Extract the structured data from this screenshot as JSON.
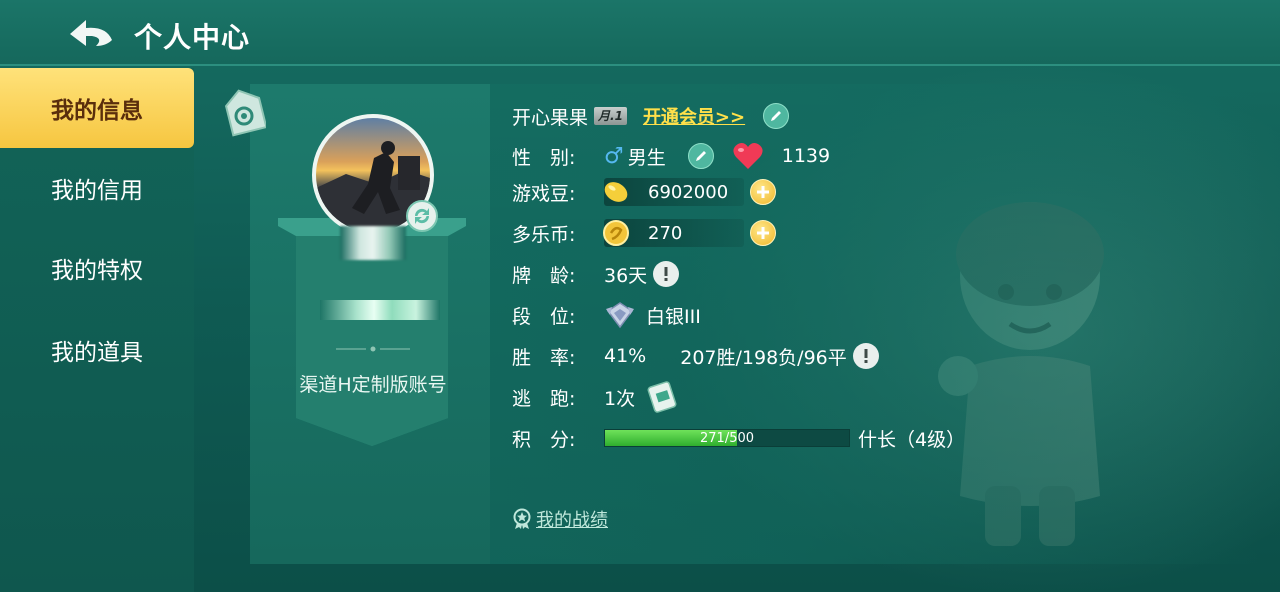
{
  "header": {
    "title": "个人中心"
  },
  "sidebar": {
    "items": [
      {
        "label": "我的信息",
        "active": true
      },
      {
        "label": "我的信用",
        "active": false
      },
      {
        "label": "我的特权",
        "active": false
      },
      {
        "label": "我的道具",
        "active": false
      }
    ]
  },
  "profile": {
    "account_type": "渠道H定制版账号"
  },
  "info": {
    "nickname": "开心果果",
    "level_badge": "月.1",
    "vip_link": "开通会员>>",
    "gender_label": "性　别:",
    "gender_symbol": "♂",
    "gender_value": "男生",
    "likes": "1139",
    "beans_label": "游戏豆:",
    "beans_value": "6902000",
    "coins_label": "多乐币:",
    "coins_value": "270",
    "age_label": "牌　龄:",
    "age_value": "36天",
    "rank_label": "段　位:",
    "rank_value": "白银III",
    "winrate_label": "胜　率:",
    "winrate_value": "41%",
    "record_value": "207胜/198负/96平",
    "escape_label": "逃　跑:",
    "escape_value": "1次",
    "score_label": "积　分:",
    "score_current": "271",
    "score_total": "/500",
    "score_fraction": 0.542,
    "title_value": "什长（4级）"
  },
  "footer": {
    "record_link": "我的战绩"
  },
  "colors": {
    "accent_yellow": "#ffe04a",
    "active_tab": "#f6c640",
    "xp_green": "#2fae2e"
  }
}
